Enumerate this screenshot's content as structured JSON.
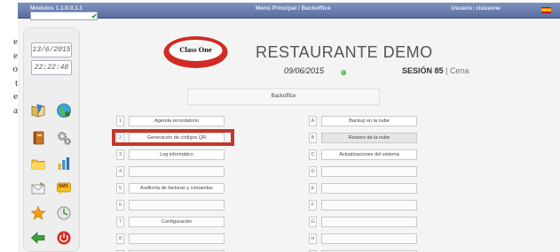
{
  "page_text": {
    "lines": [
      "e",
      "e",
      "o",
      "t",
      "e",
      "a"
    ]
  },
  "topbar": {
    "module": "Módulos 1.1.0.0.1.1",
    "menu": "Menú Principal / Backoffice",
    "user": "Usuario: classone",
    "check": "✔"
  },
  "sidebar": {
    "date": "13/6/2015",
    "time": "22:22:40",
    "icons": [
      "book-icon",
      "globe-icon",
      "notebook-icon",
      "gears-icon",
      "folder-icon",
      "bar-chart-icon",
      "mail-icon",
      "sms-icon",
      "star-icon",
      "clock-icon",
      "back-arrow-icon",
      "power-icon"
    ],
    "sms_label": "SMS"
  },
  "header": {
    "logo_text": "Class One",
    "title": "RESTAURANTE DEMO",
    "date": "09/06/2015",
    "session_label": "SESIÓN 85",
    "session_separator": " | ",
    "service": "Cena",
    "section": "Backoffice"
  },
  "colors": {
    "accent": "#c0392b",
    "topbar": "#6a7fb0",
    "status": "#2b9a2b"
  },
  "left_menu": [
    {
      "key": "1",
      "label": "Agenda recordatorio"
    },
    {
      "key": "2",
      "label": "Generación de códigos QR"
    },
    {
      "key": "3",
      "label": "Log informático"
    },
    {
      "key": "4",
      "label": ""
    },
    {
      "key": "5",
      "label": "Auditoría de facturas y comandas"
    },
    {
      "key": "6",
      "label": ""
    },
    {
      "key": "7",
      "label": "Configuración"
    },
    {
      "key": "8",
      "label": ""
    },
    {
      "key": "9",
      "label": ""
    }
  ],
  "right_menu": [
    {
      "key": "A",
      "label": "Backup en la nube"
    },
    {
      "key": "B",
      "label": "Restore de la nube"
    },
    {
      "key": "C",
      "label": "Actualizaciones del sistema"
    },
    {
      "key": "D",
      "label": ""
    },
    {
      "key": "E",
      "label": ""
    },
    {
      "key": "F",
      "label": ""
    },
    {
      "key": "G",
      "label": ""
    },
    {
      "key": "H",
      "label": ""
    },
    {
      "key": "I",
      "label": ""
    }
  ]
}
